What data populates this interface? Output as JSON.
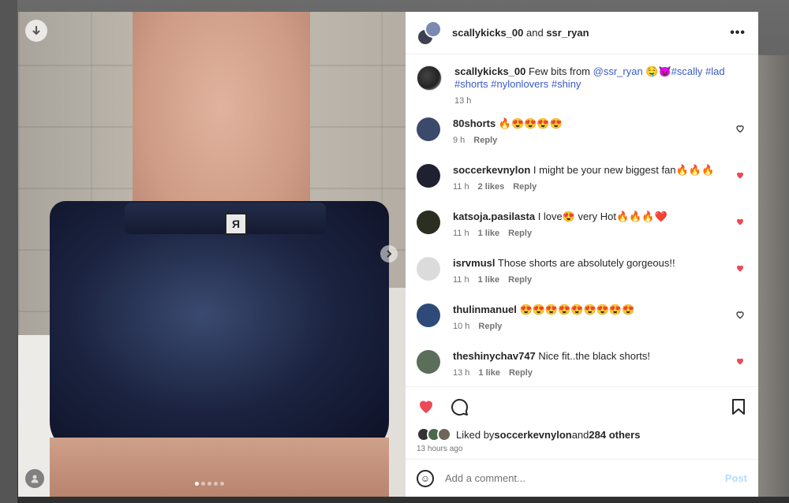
{
  "colors": {
    "like_red": "#ed4956",
    "link_blue": "#3a5bc4",
    "post_disabled": "#b2dffc",
    "muted": "#737373"
  },
  "media": {
    "tag_glyph": "Я",
    "download_icon": "arrow-down-icon",
    "next_icon": "chevron-right-icon",
    "user_tag_icon": "person-icon",
    "carousel_count": 5,
    "carousel_active": 1
  },
  "header": {
    "user1": "scallykicks_00",
    "and": "and",
    "user2": "ssr_ryan",
    "more_icon": "•••"
  },
  "caption": {
    "username": "scallykicks_00",
    "text": " Few bits from ",
    "mention": "@ssr_ryan",
    "emojis": " 🤤😈",
    "tags": "#scally #lad #shorts #nylonlovers #shiny",
    "time": "13 h"
  },
  "comments": [
    {
      "username": "80shorts",
      "text": "🔥😍😍😍😍",
      "time": "9 h",
      "likes": "",
      "reply": "Reply",
      "liked": false,
      "avatar_color": "#3b4a6b"
    },
    {
      "username": "soccerkevnylon",
      "text": "I might be your new biggest fan🔥🔥🔥",
      "time": "11 h",
      "likes": "2 likes",
      "reply": "Reply",
      "liked": true,
      "avatar_color": "#1e2130"
    },
    {
      "username": "katsoja.pasilasta",
      "text": "I love😍 very Hot🔥🔥🔥❤️",
      "time": "11 h",
      "likes": "1 like",
      "reply": "Reply",
      "liked": true,
      "avatar_color": "#2a2f22"
    },
    {
      "username": "isrvmusl",
      "text": "Those shorts are absolutely gorgeous!!",
      "time": "11 h",
      "likes": "1 like",
      "reply": "Reply",
      "liked": true,
      "avatar_color": "#dbdbdb"
    },
    {
      "username": "thulinmanuel",
      "text": "😍😍😍😍😍😍😍😍😍",
      "time": "10 h",
      "likes": "",
      "reply": "Reply",
      "liked": false,
      "avatar_color": "#2d4a78"
    },
    {
      "username": "theshinychav747",
      "text": "Nice fit..the black shorts!",
      "time": "13 h",
      "likes": "1 like",
      "reply": "Reply",
      "liked": true,
      "avatar_color": "#5a6e5a"
    }
  ],
  "actions": {
    "like_icon": "heart-filled-icon",
    "comment_icon": "comment-bubble-icon",
    "save_icon": "bookmark-icon"
  },
  "likes": {
    "prefix": "Liked by ",
    "user": "soccerkevnylon",
    "and": " and ",
    "others": "284 others"
  },
  "time_ago": "13 hours ago",
  "add_comment": {
    "placeholder": "Add a comment...",
    "post": "Post",
    "emoji_icon": "☺"
  }
}
